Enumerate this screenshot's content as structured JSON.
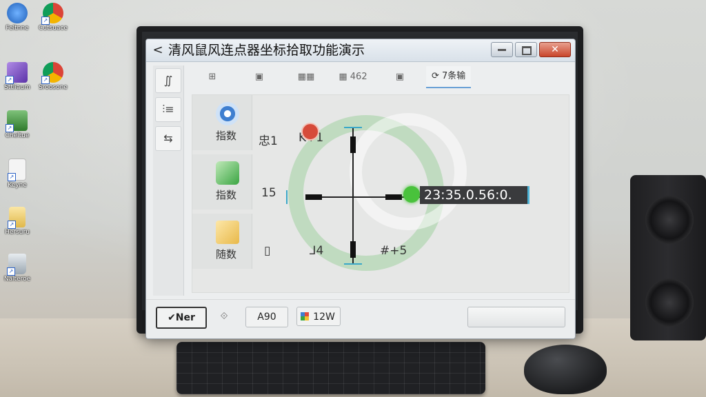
{
  "desktop": {
    "icons": [
      {
        "label": "Feltnne",
        "icon": "user-folder-icon",
        "color": "#3b7bd4"
      },
      {
        "label": "Cutsuace",
        "icon": "chrome-icon",
        "color": "#db4437"
      },
      {
        "label": "Sttliaum",
        "icon": "media-player-icon",
        "color": "#7b4fc4"
      },
      {
        "label": "Sroosone",
        "icon": "chrome-icon",
        "color": "#db4437"
      },
      {
        "label": "Cheltue",
        "icon": "computer-icon",
        "color": "#3c8d3a"
      },
      {
        "label": "Keyne",
        "icon": "document-icon",
        "color": "#e6e6e6"
      },
      {
        "label": "Hersuru",
        "icon": "text-file-icon",
        "color": "#e6c35a"
      },
      {
        "label": "Nalteroe",
        "icon": "recycle-bin-icon",
        "color": "#cfd6dc"
      }
    ]
  },
  "window": {
    "back_symbol": "<",
    "title": "清风鼠风连点器坐标拾取功能演示",
    "close_symbol": "✕"
  },
  "left_tools": [
    {
      "symbol": "∬",
      "icon": "pointer-tool-icon"
    },
    {
      "symbol": "⫶≡",
      "icon": "list-tool-icon"
    },
    {
      "symbol": "⇆",
      "icon": "swap-tool-icon"
    }
  ],
  "top_tabs": [
    {
      "label": "⊞",
      "icon": "grid-icon"
    },
    {
      "label": "▣",
      "icon": "layout-icon"
    },
    {
      "label": "▦▦",
      "icon": "table-icon"
    },
    {
      "label": "▦ 462",
      "icon": "grid-count-icon"
    },
    {
      "label": "▣",
      "icon": "save-icon"
    },
    {
      "label": "⟳ 7条输",
      "icon": "refresh-icon",
      "active": true
    }
  ],
  "rows": [
    {
      "label": "指数",
      "icon": "target-icon",
      "icon_color": "#3f7fd0"
    },
    {
      "label": "指数",
      "icon": "wine-bottle-icon",
      "icon_color": "#3aa542"
    },
    {
      "label": "随数",
      "icon": "note-icon",
      "icon_color": "#e8b94a"
    }
  ],
  "cells": {
    "r1c2": "忠1",
    "r1c3": "K+1",
    "r2c2": "15",
    "r3c2": "▯",
    "r3c3": "⅃4",
    "r3c4": "#+5"
  },
  "coordinate_readout": "23:35.0.56:0.",
  "bottom_bar": {
    "primary_button": "✔Ner",
    "diamond_symbol": "⟐",
    "a90_button": "A90",
    "w12_button": "12W",
    "w12_icon": "colorful-app-icon"
  },
  "colors": {
    "accent_green": "#49c23c",
    "ring_green": "#a0d2a0",
    "marker_red": "#d64b3a",
    "accent_blue": "#4db3d6"
  }
}
